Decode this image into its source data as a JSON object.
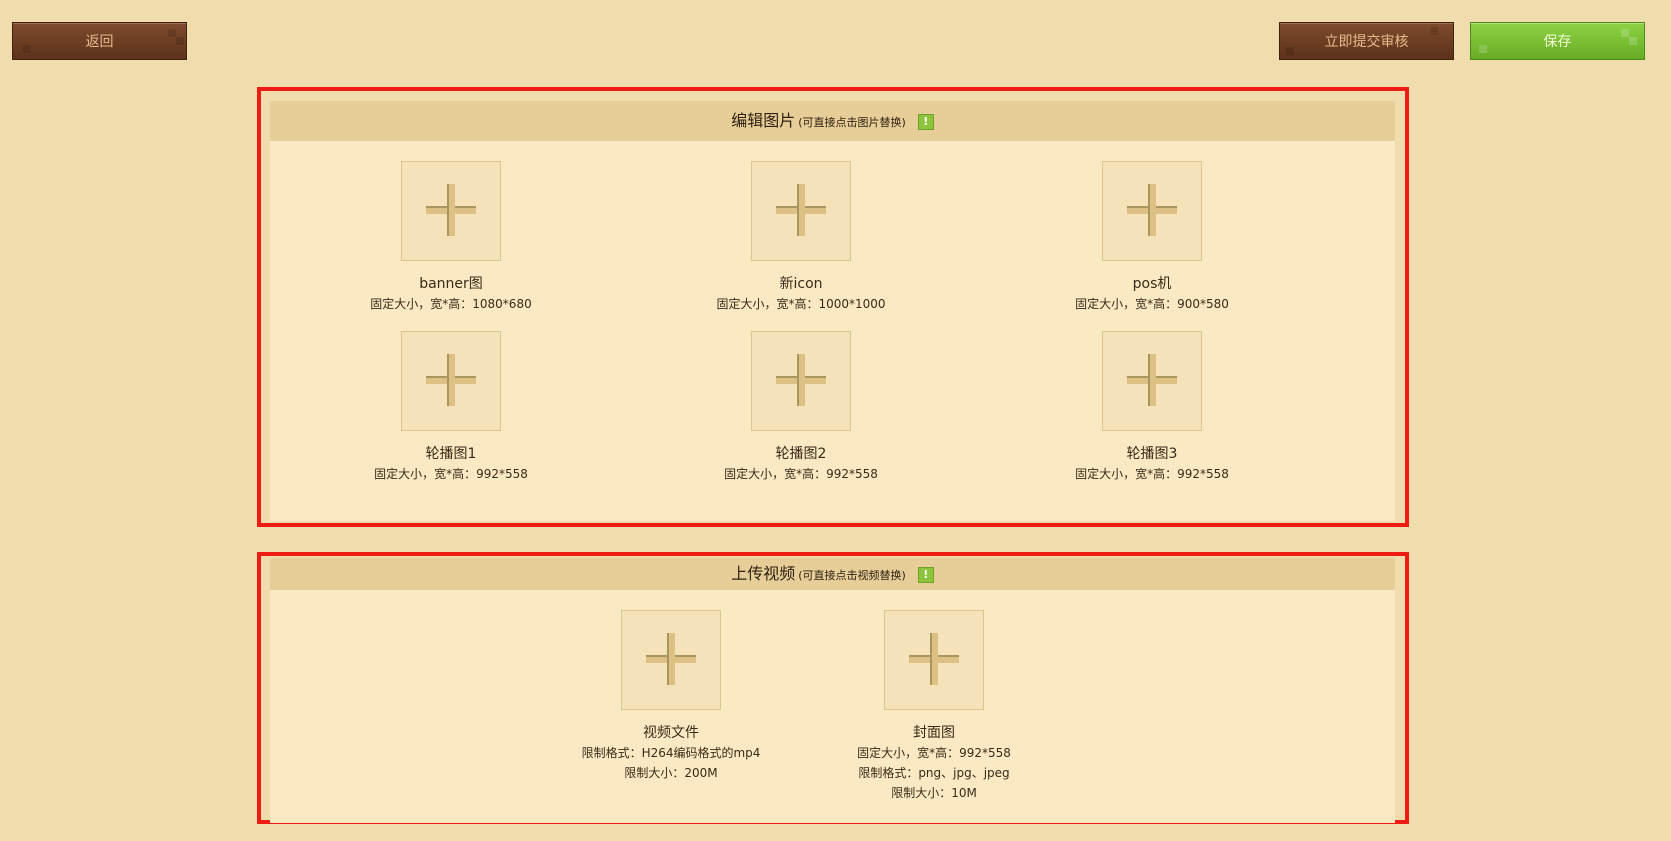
{
  "toolbar": {
    "back_label": "返回",
    "submit_label": "立即提交审核",
    "save_label": "保存"
  },
  "images_section": {
    "title": "编辑图片",
    "hint": "(可直接点击图片替换)",
    "warn_icon": "!",
    "items": [
      {
        "name": "banner图",
        "spec": "固定大小，宽*高：1080*680"
      },
      {
        "name": "新icon",
        "spec": "固定大小，宽*高：1000*1000"
      },
      {
        "name": "pos机",
        "spec": "固定大小，宽*高：900*580"
      },
      {
        "name": "轮播图1",
        "spec": "固定大小，宽*高：992*558"
      },
      {
        "name": "轮播图2",
        "spec": "固定大小，宽*高：992*558"
      },
      {
        "name": "轮播图3",
        "spec": "固定大小，宽*高：992*558"
      }
    ]
  },
  "video_section": {
    "title": "上传视频",
    "hint": "(可直接点击视频替换)",
    "warn_icon": "!",
    "video": {
      "name": "视频文件",
      "format": "限制格式：H264编码格式的mp4",
      "size": "限制大小：200M"
    },
    "cover": {
      "name": "封面图",
      "dimensions": "固定大小，宽*高：992*558",
      "format": "限制格式：png、jpg、jpeg",
      "size": "限制大小：10M"
    }
  },
  "colors": {
    "background": "#f0dcad",
    "panel": "#fbe9c3",
    "panel_header": "#e7cd97",
    "highlight_frame": "#ee1c12",
    "button_brown": "#6c3d22",
    "button_green": "#78bd32"
  },
  "icons": {
    "upload": "plus-icon",
    "notice": "warning-icon"
  }
}
